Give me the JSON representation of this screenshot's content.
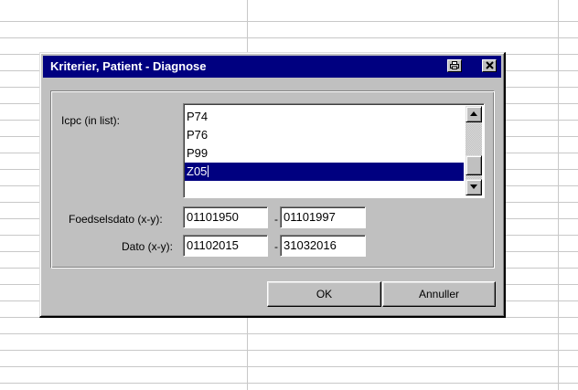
{
  "dialog": {
    "title": "Kriterier, Patient - Diagnose",
    "print_icon": "printer-icon",
    "close_label": "✕"
  },
  "icpc": {
    "label": "Icpc (in list):",
    "items": [
      "P74",
      "P76",
      "P99",
      "Z05"
    ],
    "selected_index": 3
  },
  "foedselsdato": {
    "label": "Foedselsdato (x-y):",
    "from": "01101950",
    "separator": "-",
    "to": "01101997"
  },
  "dato": {
    "label": "Dato (x-y):",
    "from": "01102015",
    "separator": "-",
    "to": "31032016"
  },
  "buttons": {
    "ok": "OK",
    "cancel": "Annuller"
  },
  "colors": {
    "titlebar": "#000080",
    "face": "#c0c0c0",
    "selection": "#000080"
  }
}
